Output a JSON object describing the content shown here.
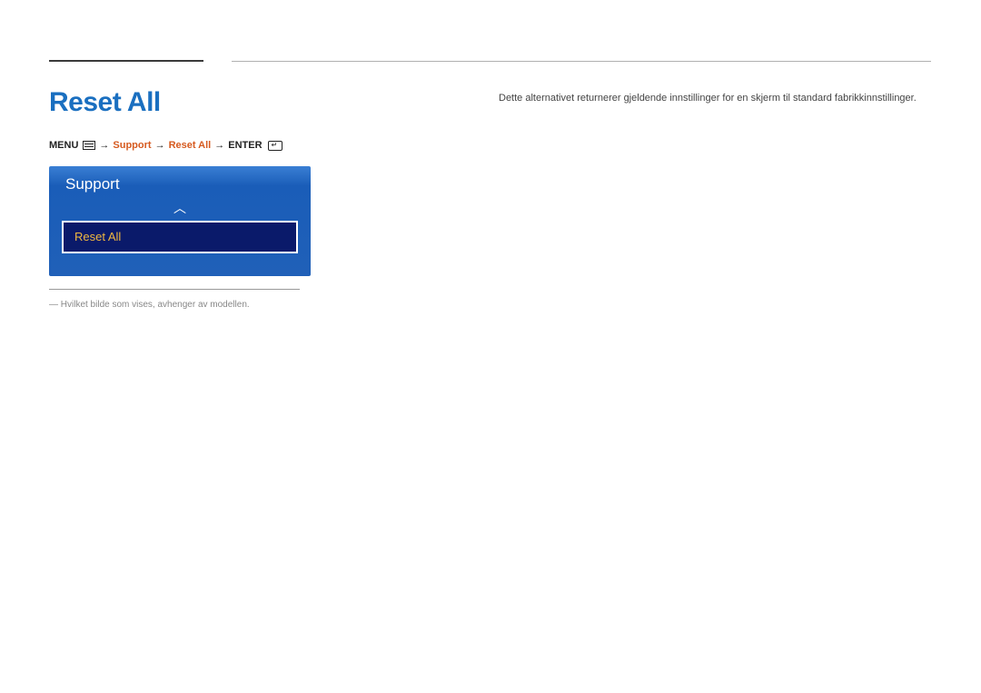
{
  "title": "Reset All",
  "breadcrumb": {
    "menu_label": "MENU",
    "support_label": "Support",
    "reset_all_label": "Reset All",
    "enter_label": "ENTER",
    "arrow": "→"
  },
  "panel": {
    "title": "Support",
    "item_label": "Reset All",
    "arrow_up": "︿"
  },
  "footnote": "― Hvilket bilde som vises, avhenger av modellen.",
  "description": "Dette alternativet returnerer gjeldende innstillinger for en skjerm til standard fabrikkinnstillinger."
}
